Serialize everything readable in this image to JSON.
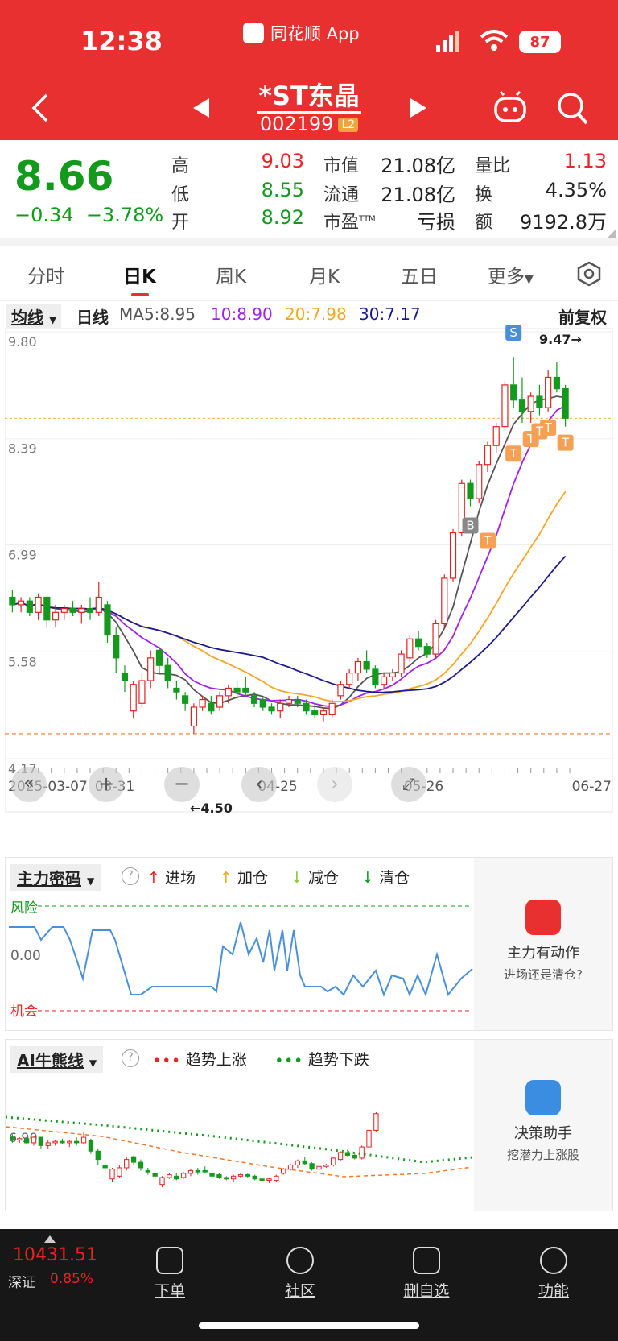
{
  "status_bar": {
    "time": "12:38",
    "app": "同花顺 App",
    "battery": "87"
  },
  "header": {
    "title": "*ST东晶",
    "code": "002199",
    "badge": "L2"
  },
  "quote": {
    "price": "8.66",
    "change": "−0.34",
    "change_pct": "−3.78%",
    "high_label": "高",
    "high": "9.03",
    "low_label": "低",
    "low": "8.55",
    "open_label": "开",
    "open": "8.92",
    "mktcap_label": "市值",
    "mktcap": "21.08亿",
    "float_label": "流通",
    "float": "21.08亿",
    "pe_label": "市盈",
    "pe_sup": "TTM",
    "pe": "亏损",
    "vr_label": "量比",
    "vr": "1.13",
    "turn_label": "换",
    "turn": "4.35%",
    "amt_label": "额",
    "amt": "9192.8万"
  },
  "tabs": [
    "分时",
    "日K",
    "周K",
    "月K",
    "五日",
    "更多"
  ],
  "ma_bar": {
    "selector": "均线",
    "period": "日线",
    "ma5": "MA5:8.95",
    "ma10": "10:8.90",
    "ma20": "20:7.98",
    "ma30": "30:7.17",
    "adjust": "前复权"
  },
  "colors": {
    "ma5": "#555555",
    "ma10": "#a020f0",
    "ma20": "#f5a623",
    "ma30": "#1a1a8c",
    "up": "#e22222",
    "down": "#139a1d"
  },
  "chart_data": {
    "type": "candlestick",
    "y_ticks": [
      "9.80",
      "8.39",
      "6.99",
      "5.58",
      "4.17"
    ],
    "x_ticks": [
      "2025-03-07",
      "03-31",
      "04-25",
      "05-26",
      "06-27"
    ],
    "max_label": "9.47→",
    "min_label": "←4.50",
    "ylim": [
      4.17,
      9.8
    ],
    "candles": [
      [
        6.3,
        6.4,
        6.1,
        6.2
      ],
      [
        6.2,
        6.3,
        6.1,
        6.25
      ],
      [
        6.25,
        6.3,
        6.05,
        6.1
      ],
      [
        6.1,
        6.35,
        6.0,
        6.3
      ],
      [
        6.3,
        6.3,
        5.9,
        6.0
      ],
      [
        6.0,
        6.2,
        5.9,
        6.1
      ],
      [
        6.1,
        6.2,
        6.0,
        6.15
      ],
      [
        6.15,
        6.25,
        6.05,
        6.1
      ],
      [
        6.1,
        6.2,
        5.95,
        6.15
      ],
      [
        6.15,
        6.3,
        6.0,
        6.1
      ],
      [
        6.1,
        6.5,
        6.05,
        6.3
      ],
      [
        6.2,
        6.25,
        5.7,
        5.8
      ],
      [
        5.8,
        5.9,
        5.3,
        5.5
      ],
      [
        5.3,
        5.4,
        5.05,
        5.2
      ],
      [
        4.8,
        5.2,
        4.7,
        5.15
      ],
      [
        4.9,
        5.3,
        4.85,
        5.2
      ],
      [
        5.2,
        5.6,
        5.1,
        5.5
      ],
      [
        5.6,
        5.65,
        5.3,
        5.4
      ],
      [
        5.4,
        5.5,
        5.1,
        5.2
      ],
      [
        5.1,
        5.2,
        4.95,
        5.05
      ],
      [
        5.0,
        5.05,
        4.8,
        4.9
      ],
      [
        4.6,
        4.9,
        4.5,
        4.85
      ],
      [
        4.85,
        5.0,
        4.8,
        4.95
      ],
      [
        4.9,
        5.0,
        4.75,
        4.8
      ],
      [
        4.85,
        5.05,
        4.8,
        5.0
      ],
      [
        5.0,
        5.15,
        4.9,
        5.1
      ],
      [
        5.1,
        5.2,
        4.95,
        5.05
      ],
      [
        5.1,
        5.25,
        5.0,
        5.05
      ],
      [
        5.0,
        5.05,
        4.85,
        4.9
      ],
      [
        4.95,
        5.0,
        4.8,
        4.85
      ],
      [
        4.85,
        4.9,
        4.75,
        4.8
      ],
      [
        4.8,
        4.95,
        4.7,
        4.9
      ],
      [
        4.9,
        5.0,
        4.85,
        4.95
      ],
      [
        4.95,
        5.0,
        4.85,
        4.9
      ],
      [
        4.9,
        4.95,
        4.75,
        4.8
      ],
      [
        4.8,
        4.9,
        4.7,
        4.75
      ],
      [
        4.75,
        4.85,
        4.65,
        4.8
      ],
      [
        4.75,
        4.95,
        4.7,
        4.9
      ],
      [
        5.0,
        5.2,
        4.95,
        5.15
      ],
      [
        5.15,
        5.35,
        5.1,
        5.3
      ],
      [
        5.3,
        5.5,
        5.2,
        5.45
      ],
      [
        5.45,
        5.6,
        5.3,
        5.35
      ],
      [
        5.35,
        5.4,
        5.1,
        5.15
      ],
      [
        5.15,
        5.3,
        5.1,
        5.25
      ],
      [
        5.25,
        5.35,
        5.2,
        5.3
      ],
      [
        5.3,
        5.6,
        5.25,
        5.55
      ],
      [
        5.5,
        5.8,
        5.45,
        5.75
      ],
      [
        5.75,
        5.85,
        5.6,
        5.65
      ],
      [
        5.65,
        5.7,
        5.5,
        5.55
      ],
      [
        5.55,
        6.0,
        5.5,
        5.95
      ],
      [
        5.95,
        6.6,
        5.9,
        6.55
      ],
      [
        6.55,
        7.2,
        6.5,
        7.15
      ],
      [
        7.15,
        7.85,
        7.1,
        7.8
      ],
      [
        7.8,
        7.85,
        7.5,
        7.6
      ],
      [
        7.6,
        8.1,
        7.55,
        8.05
      ],
      [
        8.05,
        8.35,
        7.95,
        8.3
      ],
      [
        8.3,
        8.6,
        8.2,
        8.55
      ],
      [
        8.55,
        9.15,
        8.5,
        9.1
      ],
      [
        9.1,
        9.47,
        8.8,
        8.9
      ],
      [
        8.9,
        9.2,
        8.6,
        8.75
      ],
      [
        8.75,
        9.0,
        8.6,
        8.95
      ],
      [
        8.95,
        9.1,
        8.7,
        8.8
      ],
      [
        8.8,
        9.3,
        8.75,
        9.2
      ],
      [
        9.2,
        9.4,
        9.0,
        9.05
      ],
      [
        9.05,
        9.1,
        8.55,
        8.66
      ]
    ]
  },
  "signals": [
    "S",
    "T",
    "T",
    "T",
    "T",
    "T",
    "T",
    "B"
  ],
  "chart_controls": [
    "«",
    "+",
    "−",
    "‹",
    "›",
    "⤢"
  ],
  "zhuli": {
    "title": "主力密码",
    "legend": [
      "进场",
      "加仓",
      "减仓",
      "清仓"
    ],
    "risk": "风险",
    "zero": "0.00",
    "chance": "机会",
    "side_title": "主力有动作",
    "side_sub": "进场还是清仓?"
  },
  "ai": {
    "title": "AI牛熊线",
    "legend_up": "趋势上涨",
    "legend_down": "趋势下跌",
    "tick": "6.90",
    "side_title": "决策助手",
    "side_sub": "挖潜力上涨股"
  },
  "bottom": {
    "index_value": "10431.51",
    "index_name": "深证",
    "index_pct": "0.85%",
    "nav": [
      "下单",
      "社区",
      "删自选",
      "功能"
    ]
  }
}
